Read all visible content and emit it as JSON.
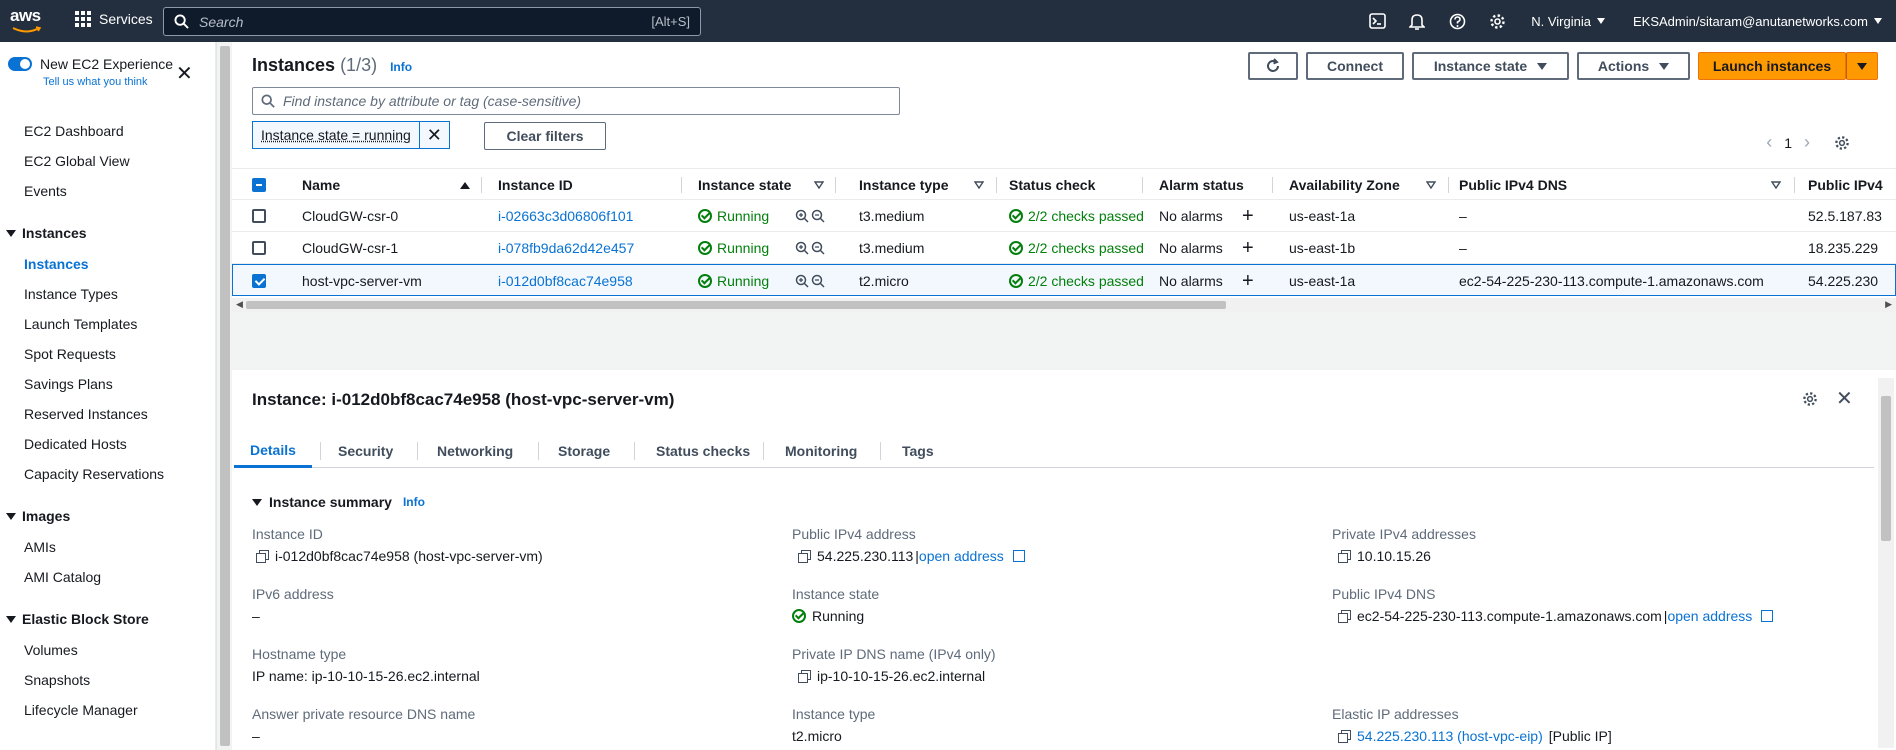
{
  "topnav": {
    "logo_text": "aws",
    "services_label": "Services",
    "search_placeholder": "Search",
    "search_shortcut": "[Alt+S]",
    "region": "N. Virginia",
    "account": "EKSAdmin/sitaram@anutanetworks.com"
  },
  "sidebar": {
    "new_experience_label": "New EC2 Experience",
    "tell_us_label": "Tell us what you think",
    "links_top": [
      "EC2 Dashboard",
      "EC2 Global View",
      "Events"
    ],
    "sections": [
      {
        "title": "Instances",
        "items": [
          "Instances",
          "Instance Types",
          "Launch Templates",
          "Spot Requests",
          "Savings Plans",
          "Reserved Instances",
          "Dedicated Hosts",
          "Capacity Reservations"
        ]
      },
      {
        "title": "Images",
        "items": [
          "AMIs",
          "AMI Catalog"
        ]
      },
      {
        "title": "Elastic Block Store",
        "items": [
          "Volumes",
          "Snapshots",
          "Lifecycle Manager"
        ]
      }
    ],
    "active_item": "Instances"
  },
  "header": {
    "title": "Instances",
    "count": "(1/3)",
    "info": "Info",
    "connect_label": "Connect",
    "instance_state_label": "Instance state",
    "actions_label": "Actions",
    "launch_label": "Launch instances"
  },
  "filter": {
    "placeholder": "Find instance by attribute or tag (case-sensitive)",
    "token": "Instance state = running",
    "clear_label": "Clear filters",
    "page": "1"
  },
  "table": {
    "columns": [
      "Name",
      "Instance ID",
      "Instance state",
      "Instance type",
      "Status check",
      "Alarm status",
      "Availability Zone",
      "Public IPv4 DNS",
      "Public IPv4"
    ],
    "rows": [
      {
        "name": "CloudGW-csr-0",
        "id": "i-02663c3d06806f101",
        "state": "Running",
        "type": "t3.medium",
        "status": "2/2 checks passed",
        "alarm": "No alarms",
        "az": "us-east-1a",
        "dns": "–",
        "ip": "52.5.187.83",
        "selected": false
      },
      {
        "name": "CloudGW-csr-1",
        "id": "i-078fb9da62d42e457",
        "state": "Running",
        "type": "t3.medium",
        "status": "2/2 checks passed",
        "alarm": "No alarms",
        "az": "us-east-1b",
        "dns": "–",
        "ip": "18.235.229",
        "selected": false
      },
      {
        "name": "host-vpc-server-vm",
        "id": "i-012d0bf8cac74e958",
        "state": "Running",
        "type": "t2.micro",
        "status": "2/2 checks passed",
        "alarm": "No alarms",
        "az": "us-east-1a",
        "dns": "ec2-54-225-230-113.compute-1.amazonaws.com",
        "ip": "54.225.230",
        "selected": true
      }
    ]
  },
  "detail": {
    "title": "Instance: i-012d0bf8cac74e958 (host-vpc-server-vm)",
    "tabs": [
      "Details",
      "Security",
      "Networking",
      "Storage",
      "Status checks",
      "Monitoring",
      "Tags"
    ],
    "summary_title": "Instance summary",
    "summary_info": "Info",
    "fields": {
      "instance_id_label": "Instance ID",
      "instance_id_value": "i-012d0bf8cac74e958 (host-vpc-server-vm)",
      "ipv6_label": "IPv6 address",
      "ipv6_value": "–",
      "hostname_type_label": "Hostname type",
      "hostname_type_value": "IP name: ip-10-10-15-26.ec2.internal",
      "answer_dns_label": "Answer private resource DNS name",
      "answer_dns_value": "–",
      "public_ipv4_label": "Public IPv4 address",
      "public_ipv4_value": "54.225.230.113",
      "public_ipv4_sep": "|",
      "open_address": "open address",
      "instance_state_label": "Instance state",
      "instance_state_value": "Running",
      "private_dns_label": "Private IP DNS name (IPv4 only)",
      "private_dns_value": "ip-10-10-15-26.ec2.internal",
      "instance_type_label": "Instance type",
      "instance_type_value": "t2.micro",
      "private_ipv4_label": "Private IPv4 addresses",
      "private_ipv4_value": "10.10.15.26",
      "public_dns_label": "Public IPv4 DNS",
      "public_dns_value": "ec2-54-225-230-113.compute-1.amazonaws.com",
      "public_dns_sep": "|",
      "elastic_ip_label": "Elastic IP addresses",
      "elastic_ip_value": "54.225.230.113 (host-vpc-eip)",
      "elastic_ip_suffix": "[Public IP]"
    }
  },
  "colors": {
    "nav_bg": "#232f3e",
    "link": "#0972d3",
    "primary_button": "#ff9900",
    "success": "#037f0c"
  }
}
